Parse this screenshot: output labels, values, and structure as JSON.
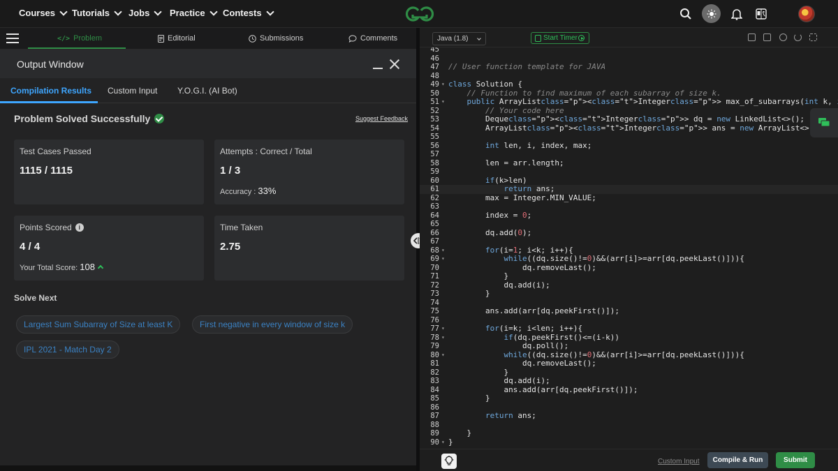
{
  "nav": {
    "items": [
      "Courses",
      "Tutorials",
      "Jobs",
      "Practice",
      "Contests"
    ]
  },
  "problem_tabs": [
    {
      "label": "Problem",
      "icon": "code-icon"
    },
    {
      "label": "Editorial",
      "icon": "document-icon"
    },
    {
      "label": "Submissions",
      "icon": "clock-icon"
    },
    {
      "label": "Comments",
      "icon": "comment-icon"
    }
  ],
  "output_window": {
    "title": "Output Window",
    "tabs": [
      "Compilation Results",
      "Custom Input",
      "Y.O.G.I. (AI Bot)"
    ],
    "status": "Problem Solved Successfully",
    "suggest_feedback": "Suggest Feedback",
    "cards": {
      "tests": {
        "label": "Test Cases Passed",
        "value": "1115 / 1115"
      },
      "attempts": {
        "label": "Attempts : Correct / Total",
        "value": "1 / 3",
        "extra_label": "Accuracy :",
        "extra_value": "33%"
      },
      "points": {
        "label": "Points Scored",
        "value": "4 / 4",
        "extra_label": "Your Total Score:",
        "extra_value": "108"
      },
      "time": {
        "label": "Time Taken",
        "value": "2.75"
      }
    },
    "solve_next_title": "Solve Next",
    "solve_next": [
      "Largest Sum Subarray of Size at least K",
      "First negative in every window of size k",
      "IPL 2021 - Match Day 2"
    ]
  },
  "editor": {
    "language": "Java (1.8)",
    "timer_label": "Start Timer",
    "custom_input": "Custom Input",
    "compile_run": "Compile & Run",
    "submit": "Submit",
    "lines": [
      {
        "n": "45",
        "fold": false,
        "code": ""
      },
      {
        "n": "46",
        "fold": false,
        "code": ""
      },
      {
        "n": "47",
        "fold": false,
        "code": "// User function template for JAVA"
      },
      {
        "n": "48",
        "fold": false,
        "code": ""
      },
      {
        "n": "49",
        "fold": true,
        "code": "class Solution {"
      },
      {
        "n": "50",
        "fold": false,
        "code": "    // Function to find maximum of each subarray of size k."
      },
      {
        "n": "51",
        "fold": true,
        "code": "    public ArrayList<Integer> max_of_subarrays(int k, int arr[]) {"
      },
      {
        "n": "52",
        "fold": false,
        "code": "        // Your code here"
      },
      {
        "n": "53",
        "fold": false,
        "code": "        Deque<Integer> dq = new LinkedList<>();"
      },
      {
        "n": "54",
        "fold": false,
        "code": "        ArrayList<Integer> ans = new ArrayList<>();"
      },
      {
        "n": "55",
        "fold": false,
        "code": ""
      },
      {
        "n": "56",
        "fold": false,
        "code": "        int len, i, index, max;"
      },
      {
        "n": "57",
        "fold": false,
        "code": ""
      },
      {
        "n": "58",
        "fold": false,
        "code": "        len = arr.length;"
      },
      {
        "n": "59",
        "fold": false,
        "code": ""
      },
      {
        "n": "60",
        "fold": false,
        "code": "        if(k>len)"
      },
      {
        "n": "61",
        "fold": false,
        "code": "            return ans;"
      },
      {
        "n": "62",
        "fold": false,
        "code": "        max = Integer.MIN_VALUE;"
      },
      {
        "n": "63",
        "fold": false,
        "code": ""
      },
      {
        "n": "64",
        "fold": false,
        "code": "        index = 0;"
      },
      {
        "n": "65",
        "fold": false,
        "code": ""
      },
      {
        "n": "66",
        "fold": false,
        "code": "        dq.add(0);"
      },
      {
        "n": "67",
        "fold": false,
        "code": ""
      },
      {
        "n": "68",
        "fold": true,
        "code": "        for(i=1; i<k; i++){"
      },
      {
        "n": "69",
        "fold": true,
        "code": "            while((dq.size()!=0)&&(arr[i]>=arr[dq.peekLast()])){"
      },
      {
        "n": "70",
        "fold": false,
        "code": "                dq.removeLast();"
      },
      {
        "n": "71",
        "fold": false,
        "code": "            }"
      },
      {
        "n": "72",
        "fold": false,
        "code": "            dq.add(i);"
      },
      {
        "n": "73",
        "fold": false,
        "code": "        }"
      },
      {
        "n": "74",
        "fold": false,
        "code": ""
      },
      {
        "n": "75",
        "fold": false,
        "code": "        ans.add(arr[dq.peekFirst()]);"
      },
      {
        "n": "76",
        "fold": false,
        "code": ""
      },
      {
        "n": "77",
        "fold": true,
        "code": "        for(i=k; i<len; i++){"
      },
      {
        "n": "78",
        "fold": true,
        "code": "            if(dq.peekFirst()<=(i-k))"
      },
      {
        "n": "79",
        "fold": false,
        "code": "                dq.poll();"
      },
      {
        "n": "80",
        "fold": true,
        "code": "            while((dq.size()!=0)&&(arr[i]>=arr[dq.peekLast()])){"
      },
      {
        "n": "81",
        "fold": false,
        "code": "                dq.removeLast();"
      },
      {
        "n": "82",
        "fold": false,
        "code": "            }"
      },
      {
        "n": "83",
        "fold": false,
        "code": "            dq.add(i);"
      },
      {
        "n": "84",
        "fold": false,
        "code": "            ans.add(arr[dq.peekFirst()]);"
      },
      {
        "n": "85",
        "fold": false,
        "code": "        }"
      },
      {
        "n": "86",
        "fold": false,
        "code": ""
      },
      {
        "n": "87",
        "fold": false,
        "code": "        return ans;"
      },
      {
        "n": "88",
        "fold": false,
        "code": ""
      },
      {
        "n": "89",
        "fold": false,
        "code": "    }"
      },
      {
        "n": "90",
        "fold": true,
        "code": "}"
      }
    ]
  }
}
